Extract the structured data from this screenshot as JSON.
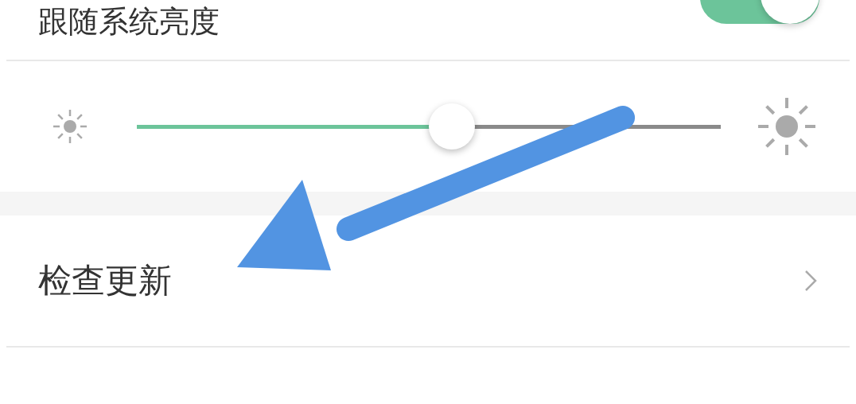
{
  "brightness": {
    "follow_system": {
      "label": "跟随系统亮度",
      "on": true
    },
    "slider": {
      "level": 0.54
    }
  },
  "items": [
    {
      "label": "检查更新"
    }
  ]
}
